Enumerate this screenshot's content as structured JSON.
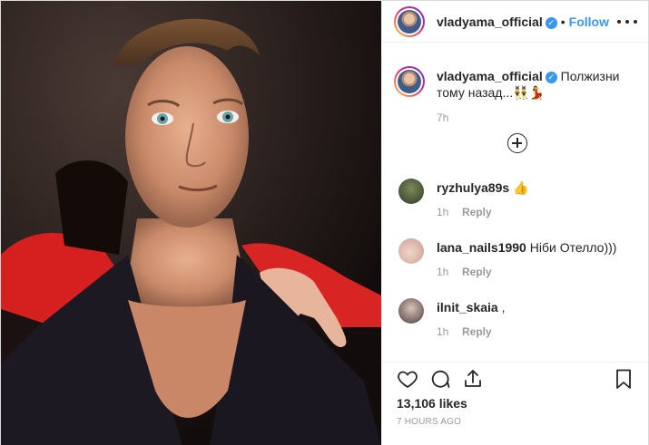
{
  "header": {
    "username": "vladyama_official",
    "follow_label": "Follow",
    "dot": "•"
  },
  "caption": {
    "username": "vladyama_official",
    "text": "Полжизни тому назад...👯‍♂️💃",
    "time": "7h"
  },
  "comments": [
    {
      "username": "ryzhulya89s",
      "text": "👍",
      "time": "1h",
      "reply_label": "Reply"
    },
    {
      "username": "lana_nails1990",
      "text": "Ніби Отелло)))",
      "time": "1h",
      "reply_label": "Reply"
    },
    {
      "username": "ilnit_skaia",
      "text": ",",
      "time": "1h",
      "reply_label": "Reply"
    }
  ],
  "footer": {
    "likes": "13,106 likes",
    "posted": "7 HOURS AGO"
  },
  "icons": {
    "more": "more-options-icon",
    "load_more": "plus-circle-icon",
    "like": "heart-icon",
    "comment": "comment-icon",
    "share": "share-icon",
    "save": "bookmark-icon"
  },
  "colors": {
    "accent": "#3897f0",
    "muted": "#999999",
    "text": "#262626",
    "border": "#efefef"
  }
}
